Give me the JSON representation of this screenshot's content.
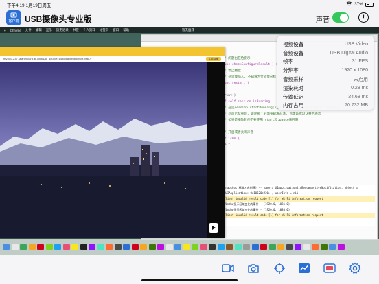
{
  "status_bar": {
    "time": "下午4:19",
    "date": "1月19日周五",
    "battery": "37%"
  },
  "header": {
    "app_title": "USB摄像头专业版",
    "logo_text": "客户端",
    "sound_label": "声音",
    "sound_enabled": true
  },
  "info_panel": {
    "rows": [
      {
        "label": "视频设备",
        "value": "USB Video"
      },
      {
        "label": "音频设备",
        "value": "USB Digital Audio"
      },
      {
        "label": "帧率",
        "value": "31 FPS"
      },
      {
        "label": "分辨率",
        "value": "1920 x 1080"
      },
      {
        "label": "音频采样",
        "value": "未启用"
      },
      {
        "label": "渲染耗时",
        "value": "0.28 ms"
      },
      {
        "label": "传输延迟",
        "value": "24.68 ms"
      },
      {
        "label": "内存占用",
        "value": "70.732 MB"
      }
    ]
  },
  "captured_screen": {
    "menubar_items": [
      "Chrome",
      "文件",
      "编辑",
      "显示",
      "历史记录",
      "书签",
      "个人资料",
      "标签页",
      "窗口",
      "帮助"
    ],
    "menubar_center": "暂无推荐",
    "browser_url": "tmv.oo3.237.search-card.all.click&ad_source=1435f8a2bf5b5eb0ff1fe6f7f",
    "browser_button": "生成直播",
    "code_lines": [
      "// 问题出在给提示",
      "func checkConfigureResult() {",
      "  // 停止播放",
      "",
      "// 这里我插入, 不知道为什么会这样",
      "func restart()",
      "{",
      "  print()",
      "  if self.session.isRunning",
      "",
      "  // 这是session.startRunning()之前不调用self.audioEngine.start方法",
      "  // 然后它就重现, 说明那个必须要解决办法, 只需改成默认开启声音",
      "  // 如果是播放暂停不要使用.start和.pause来控制",
      "  {",
      "    // 开启或者关闭声音",
      "    if isOn {",
      "      self."
    ],
    "console_lines": [
      "Snapshot(标准入库创建) -- name = UIApplicationDidBecomeActiveNotification, object =",
      "<UIApplication: 0x10620e920>), userInfo = nil",
      "Client invalid result code [1] for Wi-Fi information request",
      "",
      "Window显示区域变化的事件 - (1920.0, 1081.0)",
      "Window显示区域变化的事件 - (1920.0, 1080.0)",
      "Client invalid result code [1] for Wi-Fi information request"
    ]
  },
  "toolbar": {
    "buttons": [
      {
        "name": "record-video",
        "icon": "video-camera-icon"
      },
      {
        "name": "snapshot",
        "icon": "camera-icon"
      },
      {
        "name": "crosshair",
        "icon": "crosshair-icon"
      },
      {
        "name": "stats",
        "icon": "chart-icon"
      },
      {
        "name": "hdmi",
        "icon": "hdmi-icon"
      },
      {
        "name": "settings",
        "icon": "gear-icon"
      }
    ]
  },
  "colors": {
    "accent": "#2b6fd6",
    "toggle_on": "#34c759"
  }
}
